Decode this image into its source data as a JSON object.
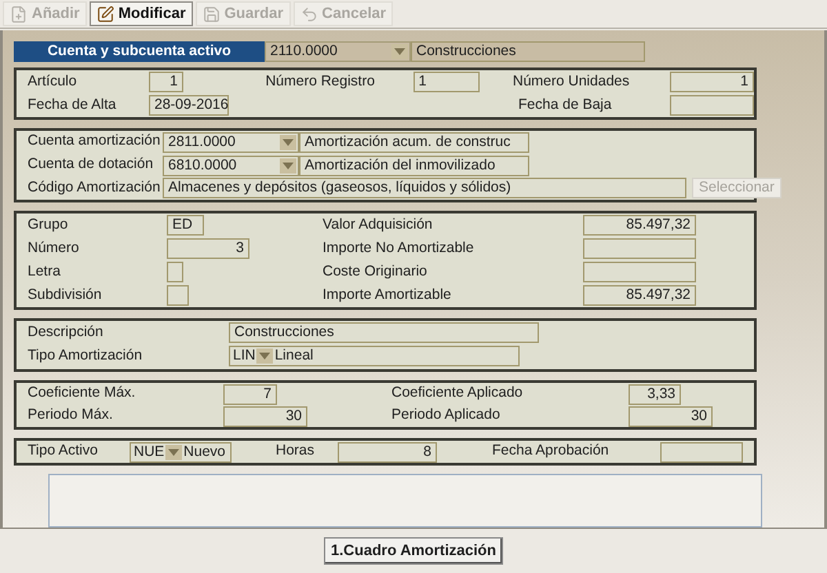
{
  "toolbar": [
    {
      "label": "Añadir",
      "kind": "add",
      "disabled": true
    },
    {
      "label": "Modificar",
      "kind": "edit",
      "disabled": false
    },
    {
      "label": "Guardar",
      "kind": "save",
      "disabled": true
    },
    {
      "label": "Cancelar",
      "kind": "undo",
      "disabled": true
    }
  ],
  "header": {
    "label": "Cuenta y subcuenta activo",
    "code": "2110.0000",
    "description": "Construcciones"
  },
  "general": {
    "articulo": {
      "label": "Artículo",
      "value": "1"
    },
    "numero_registro": {
      "label": "Número Registro",
      "value": "1"
    },
    "numero_unidades": {
      "label": "Número Unidades",
      "value": "1"
    },
    "fecha_alta": {
      "label": "Fecha de Alta",
      "value": "28-09-2016"
    },
    "fecha_baja": {
      "label": "Fecha de Baja"
    }
  },
  "cuentas": {
    "cuenta_amortizacion": {
      "label": "Cuenta amortización",
      "code": "2811.0000",
      "description": "Amortización acum. de construc"
    },
    "cuenta_dotacion": {
      "label": "Cuenta de dotación",
      "code": "6810.0000",
      "description": "Amortización del inmovilizado"
    },
    "codigo_amortizacion": {
      "label": "Código Amortización",
      "value": "Almacenes y depósitos (gaseosos, líquidos y sólidos)"
    },
    "select_button": {
      "label": "Seleccionar",
      "disabled": true
    }
  },
  "clasificacion": {
    "left": [
      {
        "label": "Grupo",
        "value": "ED"
      },
      {
        "label": "Número",
        "value": "3"
      },
      {
        "label": "Letra"
      },
      {
        "label": "Subdivisión"
      }
    ],
    "right": [
      {
        "label": "Valor Adquisición",
        "value": "85.497,32"
      },
      {
        "label": "Importe No Amortizable"
      },
      {
        "label": "Coste Originario"
      },
      {
        "label": "Importe Amortizable",
        "value": "85.497,32"
      }
    ]
  },
  "descripcion": {
    "label": "Descripción",
    "value": "Construcciones"
  },
  "tipo_amortizacion": {
    "label": "Tipo Amortización",
    "code": "LIN",
    "description": "Lineal"
  },
  "coeficientes": {
    "coeficiente_max": {
      "label": "Coeficiente Máx.",
      "value": "7"
    },
    "coeficiente_aplicado": {
      "label": "Coeficiente Aplicado",
      "value": "3,33"
    },
    "periodo_max": {
      "label": "Periodo Máx.",
      "value": "30"
    },
    "periodo_aplicado": {
      "label": "Periodo Aplicado",
      "value": "30"
    }
  },
  "tipo_activo": {
    "label": "Tipo Activo",
    "code": "NUE",
    "description": "Nuevo"
  },
  "horas": {
    "label": "Horas",
    "value": "8"
  },
  "fecha_aprobacion": {
    "label": "Fecha Aprobación"
  },
  "bottom_button": {
    "label": "1.Cuadro Amortización"
  }
}
